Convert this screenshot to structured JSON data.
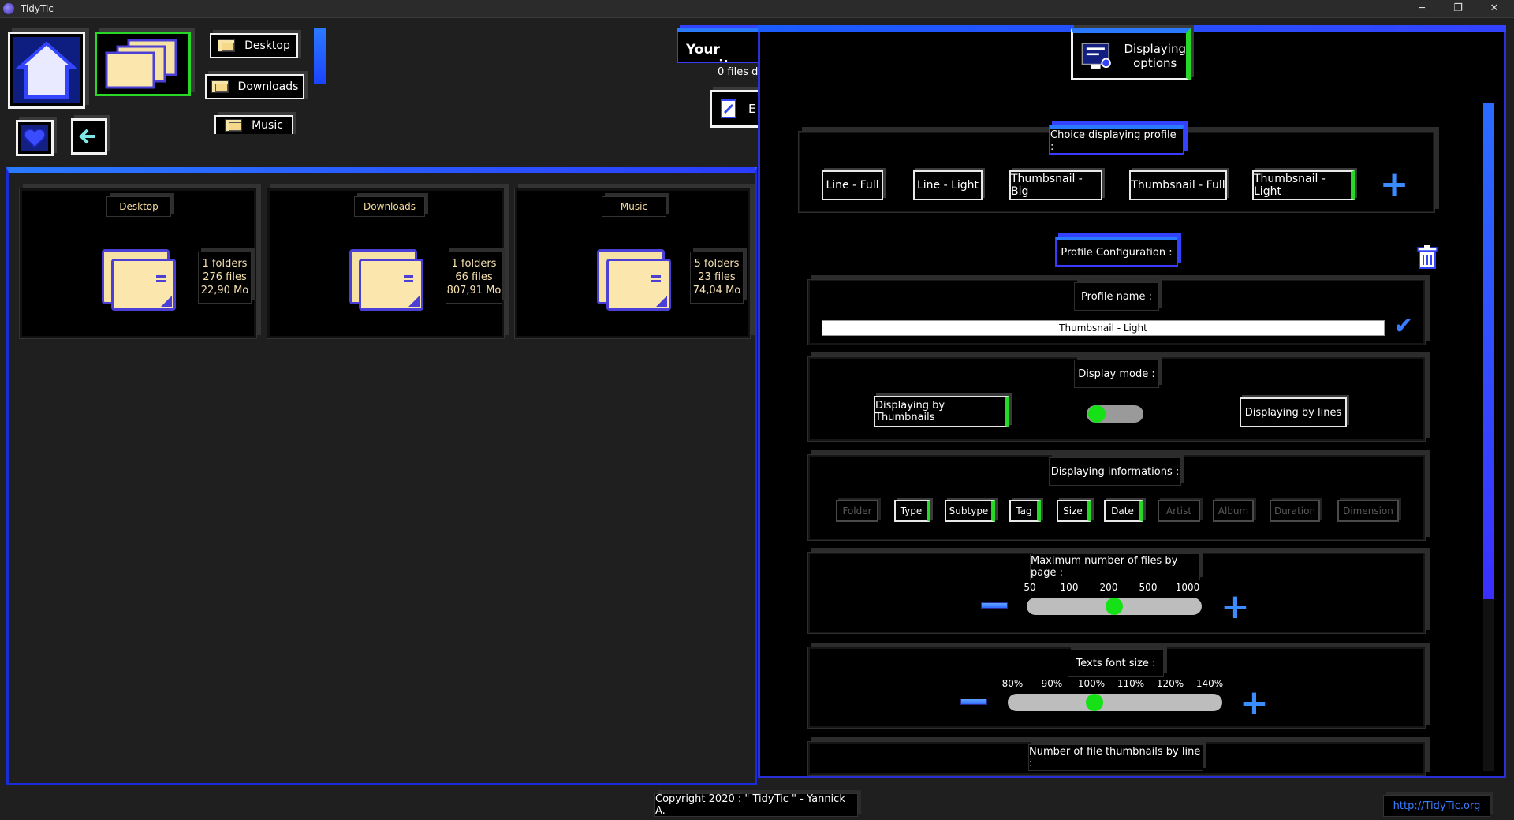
{
  "window": {
    "title": "TidyTic",
    "minimize": "─",
    "restore": "❐",
    "close": "✕"
  },
  "nav": {
    "home_icon": "home-icon",
    "explorer_icon": "folders-icon",
    "favorites_icon": "heart-icon",
    "back_icon": "back-arrow-icon",
    "shortcuts": [
      "Desktop",
      "Downloads",
      "Music"
    ]
  },
  "monitor": {
    "title": "Your monito",
    "subtitle": "0 files d",
    "edit_label": "E"
  },
  "folders": [
    {
      "name": "Desktop",
      "folders": "1 folders",
      "files": "276 files",
      "size": "22,90 Mo"
    },
    {
      "name": "Downloads",
      "folders": "1 folders",
      "files": "66 files",
      "size": "807,91 Mo"
    },
    {
      "name": "Music",
      "folders": "5 folders",
      "files": "23 files",
      "size": "74,04 Mo"
    }
  ],
  "display_options": {
    "header": "Displaying\noptions",
    "choice_label": "Choice displaying profile :",
    "profiles": [
      "Line - Full",
      "Line - Light",
      "Thumbsnail - Big",
      "Thumbsnail - Full",
      "Thumbsnail - Light"
    ],
    "active_profile": "Thumbsnail - Light",
    "add_symbol": "+",
    "config_label": "Profile Configuration :",
    "profile_name_label": "Profile name :",
    "profile_name_value": "Thumbsnail - Light",
    "confirm_symbol": "✔",
    "display_mode_label": "Display mode :",
    "mode_thumbnails": "Displaying by Thumbnails",
    "mode_lines": "Displaying by lines",
    "mode_selected": "thumbnails",
    "info_label": "Displaying informations :",
    "info_tags": [
      {
        "label": "Folder",
        "on": false
      },
      {
        "label": "Type",
        "on": true
      },
      {
        "label": "Subtype",
        "on": true
      },
      {
        "label": "Tag",
        "on": true
      },
      {
        "label": "Size",
        "on": true
      },
      {
        "label": "Date",
        "on": true
      },
      {
        "label": "Artist",
        "on": false
      },
      {
        "label": "Album",
        "on": false
      },
      {
        "label": "Duration",
        "on": false
      },
      {
        "label": "Dimension",
        "on": false
      }
    ],
    "max_files_label": "Maximum number of files by page :",
    "max_files_ticks": [
      "50",
      "100",
      "200",
      "500",
      "1000"
    ],
    "max_files_value": "200",
    "font_size_label": "Texts font size :",
    "font_size_ticks": [
      "80%",
      "90%",
      "100%",
      "110%",
      "120%",
      "140%"
    ],
    "font_size_value": "100%",
    "thumbs_label": "Number of file thumbnails by line :"
  },
  "footer": {
    "copyright": "Copyright 2020 : \" TidyTic \" - Yannick A.",
    "link": "http://TidyTic.org"
  },
  "colors": {
    "accent_blue": "#2a6cff",
    "accent_green": "#27d827",
    "folder_yellow": "#f7e2a6"
  }
}
